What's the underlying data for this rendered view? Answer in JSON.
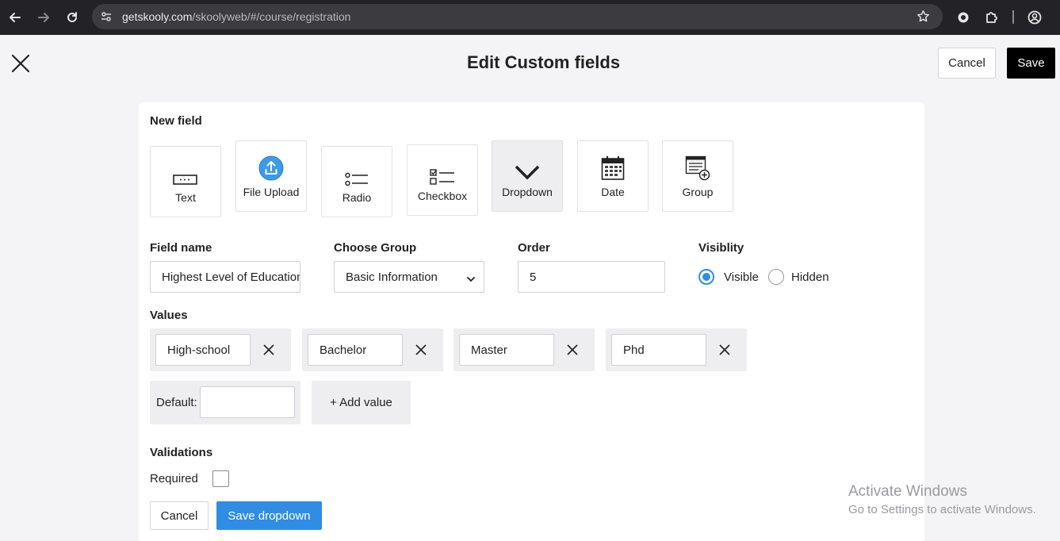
{
  "browser": {
    "url_host": "getskooly.com",
    "url_path": "/skoolyweb/#/course/registration"
  },
  "header": {
    "title": "Edit Custom fields",
    "cancel_label": "Cancel",
    "save_label": "Save"
  },
  "new_field": {
    "heading": "New field",
    "types": [
      {
        "label": "Text",
        "icon": "text-field-icon"
      },
      {
        "label": "File Upload",
        "icon": "upload-icon"
      },
      {
        "label": "Radio",
        "icon": "radio-list-icon"
      },
      {
        "label": "Checkbox",
        "icon": "checkbox-list-icon"
      },
      {
        "label": "Dropdown",
        "icon": "chevron-down-icon",
        "selected": true
      },
      {
        "label": "Date",
        "icon": "calendar-icon"
      },
      {
        "label": "Group",
        "icon": "group-add-icon"
      }
    ]
  },
  "form": {
    "field_name_label": "Field name",
    "field_name_value": "Highest Level of Education",
    "choose_group_label": "Choose Group",
    "choose_group_value": "Basic Information",
    "order_label": "Order",
    "order_value": "5",
    "visibility_label": "Visiblity",
    "visibility_options": [
      "Visible",
      "Hidden"
    ],
    "visibility_selected": "Visible"
  },
  "values": {
    "label": "Values",
    "items": [
      "High-school",
      "Bachelor",
      "Master",
      "Phd"
    ],
    "default_label": "Default:",
    "default_value": "",
    "add_value_label": "+ Add value"
  },
  "validations": {
    "label": "Validations",
    "required_label": "Required",
    "required_checked": false
  },
  "footer": {
    "cancel_label": "Cancel",
    "save_label": "Save dropdown"
  },
  "watermark": {
    "line1": "Activate Windows",
    "line2": "Go to Settings to activate Windows."
  },
  "colors": {
    "accent": "#2f8de4",
    "primary_dark": "#000000",
    "card_bg": "#ffffff",
    "page_bg": "#f4f4f6"
  }
}
